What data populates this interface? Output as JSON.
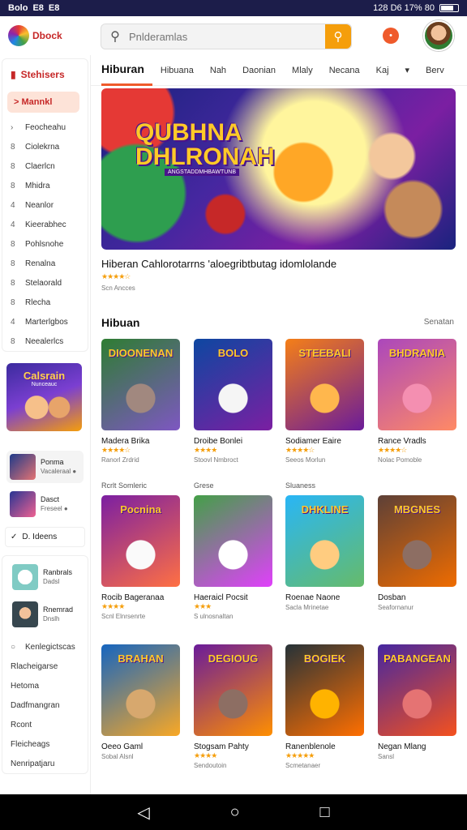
{
  "status": {
    "left": [
      "Bolo",
      "E8",
      "E8"
    ],
    "right": "128 D6 17% 80"
  },
  "app": {
    "logo_text": "Dbock"
  },
  "search": {
    "placeholder": "Pnlderamlas"
  },
  "notification": {
    "icon": "bell-icon",
    "count": "•"
  },
  "sidebar": {
    "header": "Stehisers",
    "active": "Mannkl",
    "items": [
      "Feocheahu",
      "Ciolekrna",
      "Claerlcn",
      "Mhidra",
      "Neanlor",
      "Kieerabhec",
      "Pohlsnohe",
      "Renalna",
      "Stelaorald",
      "Rlecha",
      "Marterlgbos",
      "Neealerlcs"
    ],
    "promo": {
      "title": "Calsrain",
      "sub": "Nunceauc"
    },
    "minis": [
      {
        "title": "Ponma",
        "sub": "Vacaleraal ●"
      },
      {
        "title": "Dasct",
        "sub": "Freseel ●"
      }
    ],
    "link1": "D. Ideens",
    "minis2": [
      {
        "title": "Ranbrals",
        "sub": "Dadsl"
      },
      {
        "title": "Rnemrad",
        "sub": "Dnslh"
      }
    ],
    "link2": "Kenlegictscas",
    "bottom_items": [
      "Rlacheigarse",
      "Hetoma",
      "Dadfmangran",
      "Rcont",
      "Fleicheags",
      "Nenripatjaru"
    ]
  },
  "tabs": [
    "Hiburan",
    "Hibuana",
    "Nah",
    "Daonian",
    "Mlaly",
    "Necana",
    "Kaj",
    "▾",
    "Berv"
  ],
  "banner": {
    "title_line1": "QUBHNA",
    "title_line2": "DHLRONAH",
    "subtitle": "ANGSTADDMHBAWTUNB"
  },
  "featured": {
    "title": "Hiberan Cahlorotarrns 'aloegribtbutag idomlolande",
    "stars": "★★★★☆",
    "meta": "Scn Ancces"
  },
  "section": {
    "title": "Hibuan",
    "more": "Senatan"
  },
  "row_labels": [
    "Rcrlt Somleric",
    "Grese",
    "Sluaness"
  ],
  "games": [
    {
      "title": "Madera Brika",
      "thumb_text": "DIOONENAN",
      "stars": "★★★★☆",
      "meta": "Ranorl Zrdrid",
      "c1": "#2e7d32",
      "c2": "#7e57c2",
      "ch": "#a1887f"
    },
    {
      "title": "Droibe Bonlei",
      "thumb_text": "BOLO",
      "stars": "★★★★",
      "meta": "Stoovl Nmbroct",
      "c1": "#0d47a1",
      "c2": "#7b1fa2",
      "ch": "#f5f5f5"
    },
    {
      "title": "Sodiamer Eaire",
      "thumb_text": "STEEBALI",
      "stars": "★★★★☆",
      "meta": "Seeos Morlun",
      "c1": "#f57f17",
      "c2": "#6a1b9a",
      "ch": "#ffb74d"
    },
    {
      "title": "Rance Vradls",
      "thumb_text": "BHDRANIA",
      "stars": "★★★★☆",
      "meta": "Nolac Pomoble",
      "c1": "#ab47bc",
      "c2": "#ff8a65",
      "ch": "#f48fb1"
    },
    {
      "title": "Rocib Bageranaa",
      "thumb_text": "Pocnina",
      "stars": "★★★★",
      "meta": "Scnl Elnrsenrte",
      "c1": "#7b1fa2",
      "c2": "#ff7043",
      "ch": "#fafafa"
    },
    {
      "title": "Haeraicl Pocsit",
      "thumb_text": "",
      "stars": "★★★",
      "meta": "S ulnosnaltan",
      "c1": "#43a047",
      "c2": "#e040fb",
      "ch": "#ffffff"
    },
    {
      "title": "Roenae Naone",
      "thumb_text": "DHKLINE",
      "stars": "",
      "meta": "Sacla Mrinetae",
      "c1": "#29b6f6",
      "c2": "#66bb6a",
      "ch": "#ffcc80"
    },
    {
      "title": "Dosban",
      "thumb_text": "MBGNES",
      "stars": "",
      "meta": "Seafornanur",
      "c1": "#5d4037",
      "c2": "#ef6c00",
      "ch": "#8d6e63"
    },
    {
      "title": "Oeeo Gaml",
      "thumb_text": "BRAHAN",
      "stars": "",
      "meta": "Sobal Alsnl",
      "c1": "#1565c0",
      "c2": "#f9a825",
      "ch": "#d7a86e"
    },
    {
      "title": "Stogsam Pahty",
      "thumb_text": "DEGIOUG",
      "stars": "★★★★",
      "meta": "Sendoutoin",
      "c1": "#6a1b9a",
      "c2": "#ff8f00",
      "ch": "#8d6e63"
    },
    {
      "title": "Ranenblenole",
      "thumb_text": "BOGIEK",
      "stars": "★★★★★",
      "meta": "Scmetanaer",
      "c1": "#263238",
      "c2": "#ff6f00",
      "ch": "#ffb300"
    },
    {
      "title": "Negan Mlang",
      "thumb_text": "PABANGEAN",
      "stars": "",
      "meta": "Sansl",
      "c1": "#4527a0",
      "c2": "#f4511e",
      "ch": "#e57373"
    }
  ]
}
